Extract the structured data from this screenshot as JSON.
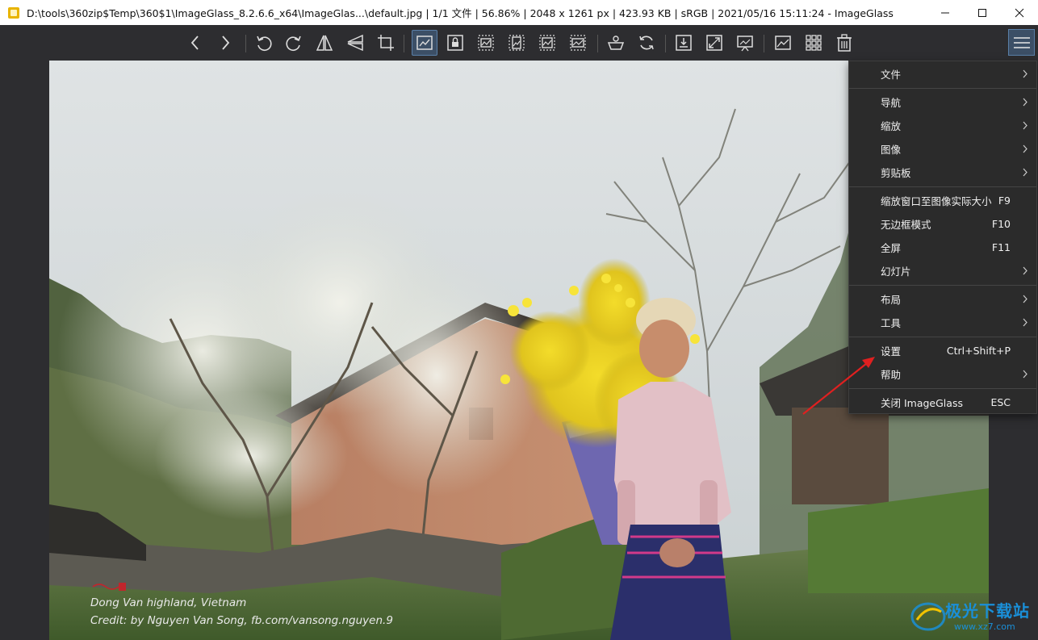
{
  "window": {
    "title": "D:\\tools\\360zip$Temp\\360$1\\ImageGlass_8.2.6.6_x64\\ImageGlas...\\default.jpg  |  1/1 文件  |  56.86%  |  2048 x 1261 px  |  423.93 KB  |  sRGB  |  2021/05/16 15:11:24  - ImageGlass"
  },
  "toolbar": {
    "icons": [
      "chevron-left-icon",
      "chevron-right-icon",
      "rotate-left-icon",
      "rotate-right-icon",
      "flip-horizontal-icon",
      "flip-vertical-icon",
      "crop-icon",
      "auto-zoom-icon",
      "lock-zoom-icon",
      "scale-width-icon",
      "scale-height-icon",
      "scale-to-fit-icon",
      "scale-to-fill-icon",
      "open-with-icon",
      "refresh-icon",
      "goto-image-icon",
      "fullscreen-icon",
      "slideshow-icon",
      "thumbnail-icon",
      "checkerboard-icon",
      "delete-icon",
      "menu-icon"
    ]
  },
  "image": {
    "caption_line1": "Dong Van highland, Vietnam",
    "caption_line2": "Credit: by Nguyen Van Song, fb.com/vansong.nguyen.9"
  },
  "menu": {
    "items": [
      {
        "label": "文件",
        "shortcut": "",
        "submenu": true
      },
      {
        "label": "导航",
        "shortcut": "",
        "submenu": true
      },
      {
        "label": "缩放",
        "shortcut": "",
        "submenu": true
      },
      {
        "label": "图像",
        "shortcut": "",
        "submenu": true
      },
      {
        "label": "剪贴板",
        "shortcut": "",
        "submenu": true
      },
      {
        "label": "缩放窗口至图像实际大小",
        "shortcut": "F9",
        "submenu": false
      },
      {
        "label": "无边框模式",
        "shortcut": "F10",
        "submenu": false
      },
      {
        "label": "全屏",
        "shortcut": "F11",
        "submenu": false
      },
      {
        "label": "幻灯片",
        "shortcut": "",
        "submenu": true
      },
      {
        "label": "布局",
        "shortcut": "",
        "submenu": true
      },
      {
        "label": "工具",
        "shortcut": "",
        "submenu": true
      },
      {
        "label": "设置",
        "shortcut": "Ctrl+Shift+P",
        "submenu": false
      },
      {
        "label": "帮助",
        "shortcut": "",
        "submenu": true
      },
      {
        "label": "关闭 ImageGlass",
        "shortcut": "ESC",
        "submenu": false
      }
    ]
  },
  "watermark": {
    "brand": "极光下载站",
    "url": "www.xz7.com"
  },
  "colors": {
    "accent": "#3c4f66",
    "menu_bg": "#2b2b2b",
    "annotation": "#e02020"
  }
}
